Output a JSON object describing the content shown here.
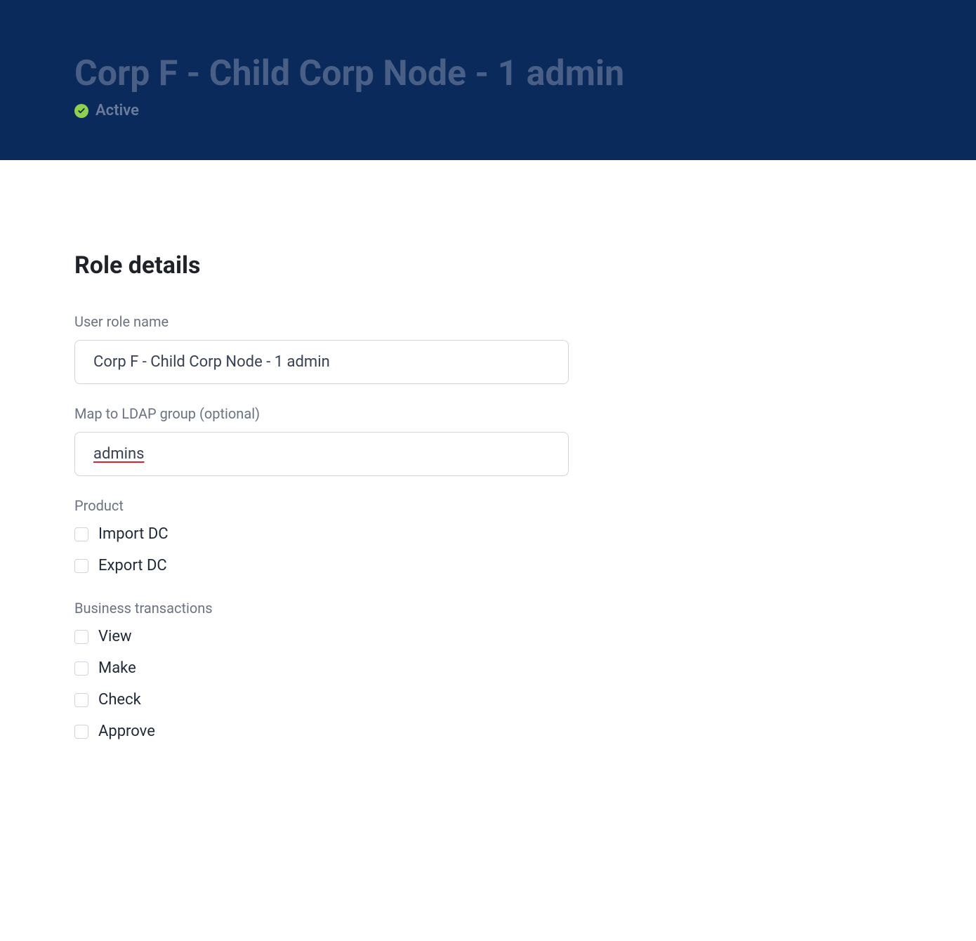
{
  "header": {
    "title": "Corp F - Child Corp Node - 1 admin",
    "status_label": "Active"
  },
  "section": {
    "title": "Role details"
  },
  "fields": {
    "role_name_label": "User role name",
    "role_name_value": "Corp F - Child Corp Node - 1 admin",
    "ldap_label": "Map to LDAP group (optional)",
    "ldap_value": "admins"
  },
  "product": {
    "label": "Product",
    "items": [
      "Import DC",
      "Export DC"
    ]
  },
  "transactions": {
    "label": "Business transactions",
    "items": [
      "View",
      "Make",
      "Check",
      "Approve"
    ]
  }
}
